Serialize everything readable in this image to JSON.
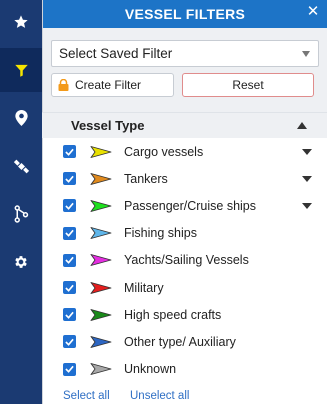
{
  "sidebar": {
    "items": [
      {
        "name": "favorites",
        "icon": "star-icon",
        "active": false
      },
      {
        "name": "filters",
        "icon": "filter-icon",
        "active": true
      },
      {
        "name": "locations",
        "icon": "map-pin-icon",
        "active": false
      },
      {
        "name": "satellite",
        "icon": "satellite-icon",
        "active": false
      },
      {
        "name": "routes",
        "icon": "route-icon",
        "active": false
      },
      {
        "name": "settings",
        "icon": "gear-icon",
        "active": false
      }
    ],
    "bg_color": "#1b3a72",
    "active_icon_color": "#f5e400"
  },
  "header": {
    "title": "VESSEL FILTERS",
    "bg_color": "#1d74c7"
  },
  "saved_filter": {
    "value": "Select Saved Filter"
  },
  "buttons": {
    "create_filter": "Create Filter",
    "reset": "Reset"
  },
  "vessel_type": {
    "label": "Vessel Type",
    "items": [
      {
        "label": "Cargo vessels",
        "color": "#e8e000",
        "checked": true,
        "expandable": true
      },
      {
        "label": "Tankers",
        "color": "#e08a1e",
        "checked": true,
        "expandable": true
      },
      {
        "label": "Passenger/Cruise ships",
        "color": "#1ee01e",
        "checked": true,
        "expandable": true
      },
      {
        "label": "Fishing ships",
        "color": "#5fb6ea",
        "checked": true,
        "expandable": false
      },
      {
        "label": "Yachts/Sailing Vessels",
        "color": "#e42ee0",
        "checked": true,
        "expandable": false
      },
      {
        "label": "Military",
        "color": "#e41e1e",
        "checked": true,
        "expandable": false
      },
      {
        "label": "High speed crafts",
        "color": "#1a8a1a",
        "checked": true,
        "expandable": false
      },
      {
        "label": "Other type/ Auxiliary",
        "color": "#2d66c2",
        "checked": true,
        "expandable": false
      },
      {
        "label": "Unknown",
        "color": "#a8a8a8",
        "checked": true,
        "expandable": false
      }
    ]
  },
  "links": {
    "select_all": "Select all",
    "unselect_all": "Unselect all"
  }
}
